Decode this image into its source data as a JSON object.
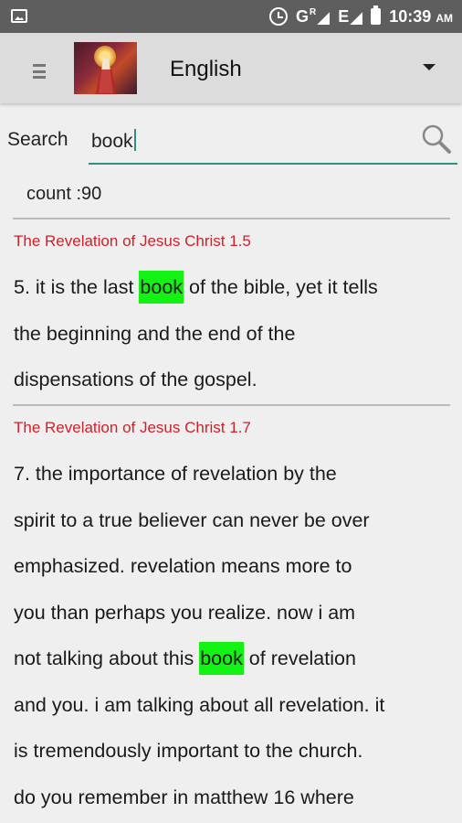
{
  "status_bar": {
    "time": "10:39",
    "ampm": "AM",
    "network_1": "G",
    "network_1_sup": "R",
    "network_2": "E",
    "icons": [
      "gallery-icon",
      "alarm-icon",
      "signal-icon",
      "signal-icon",
      "battery-icon"
    ]
  },
  "toolbar": {
    "language": "English"
  },
  "search": {
    "label": "Search",
    "value": "book"
  },
  "results_count": "count :90",
  "results": [
    {
      "title": "The Revelation of Jesus Christ 1.5",
      "lines": [
        {
          "before": "5. it is the last ",
          "match": "book",
          "after": " of the bible, yet it tells"
        },
        {
          "text": "the beginning and the end of the"
        },
        {
          "text": "dispensations of the gospel."
        }
      ]
    },
    {
      "title": "The Revelation of Jesus Christ 1.7",
      "lines": [
        {
          "text": "7. the importance of revelation by the"
        },
        {
          "text": "spirit to a true believer can never be over"
        },
        {
          "text": "emphasized. revelation means more to"
        },
        {
          "text": "you than perhaps you realize. now i am"
        },
        {
          "before": "not talking about this ",
          "match": "book",
          "after": " of revelation"
        },
        {
          "text": "and you. i am talking about all revelation. it"
        },
        {
          "text": "is tremendously important to the church."
        },
        {
          "text": "do you remember in matthew 16 where"
        }
      ]
    }
  ],
  "colors": {
    "status_bar": "#5e5e5e",
    "toolbar": "#dcdcdc",
    "accent": "#2f8f84",
    "result_title": "#d2202a",
    "highlight": "#13f313"
  }
}
